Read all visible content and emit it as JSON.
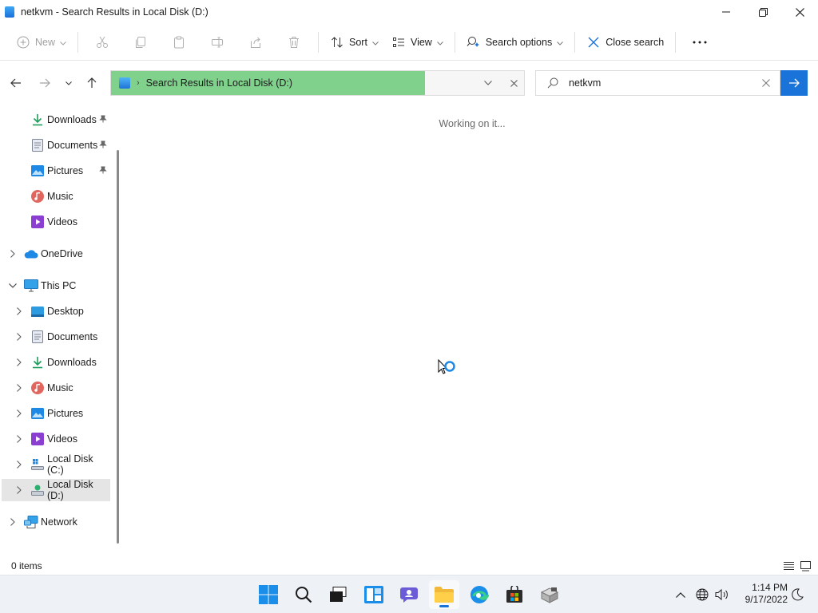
{
  "window": {
    "title": "netkvm - Search Results in Local Disk (D:)",
    "controls": [
      "minimize-icon",
      "maximize-icon",
      "close-icon"
    ]
  },
  "toolbar": {
    "new_label": "New",
    "sort_label": "Sort",
    "view_label": "View",
    "search_options_label": "Search options",
    "close_search_label": "Close search",
    "more_label": "···"
  },
  "address": {
    "path": "Search Results in Local Disk (D:)",
    "progress_fraction": 0.76
  },
  "search": {
    "value": "netkvm"
  },
  "nav": {
    "quick_access": [
      {
        "label": "Downloads",
        "icon": "download-icon",
        "pinned": true
      },
      {
        "label": "Documents",
        "icon": "document-icon",
        "pinned": true
      },
      {
        "label": "Pictures",
        "icon": "picture-icon",
        "pinned": true
      },
      {
        "label": "Music",
        "icon": "music-icon",
        "pinned": false
      },
      {
        "label": "Videos",
        "icon": "video-icon",
        "pinned": false
      }
    ],
    "onedrive": "OneDrive",
    "this_pc": "This PC",
    "this_pc_items": [
      {
        "label": "Desktop",
        "icon": "desktop-icon"
      },
      {
        "label": "Documents",
        "icon": "document-icon"
      },
      {
        "label": "Downloads",
        "icon": "download-icon"
      },
      {
        "label": "Music",
        "icon": "music-icon"
      },
      {
        "label": "Pictures",
        "icon": "picture-icon"
      },
      {
        "label": "Videos",
        "icon": "video-icon"
      },
      {
        "label": "Local Disk (C:)",
        "icon": "drive-c-icon"
      },
      {
        "label": "Local Disk (D:)",
        "icon": "drive-d-icon",
        "selected": true
      }
    ],
    "network": "Network"
  },
  "content": {
    "status_message": "Working on it..."
  },
  "statusbar": {
    "items_count": "0 items"
  },
  "taskbar": {
    "apps": [
      "start-icon",
      "search-icon",
      "task-view-icon",
      "widgets-icon",
      "chat-icon",
      "file-explorer-icon",
      "edge-icon",
      "store-icon",
      "app-icon"
    ],
    "active_app": "file-explorer-icon",
    "time": "1:14 PM",
    "date": "9/17/2022"
  },
  "colors": {
    "accent": "#1a73d8",
    "progress": "#7fd18b",
    "selection": "#e5e5e5"
  }
}
